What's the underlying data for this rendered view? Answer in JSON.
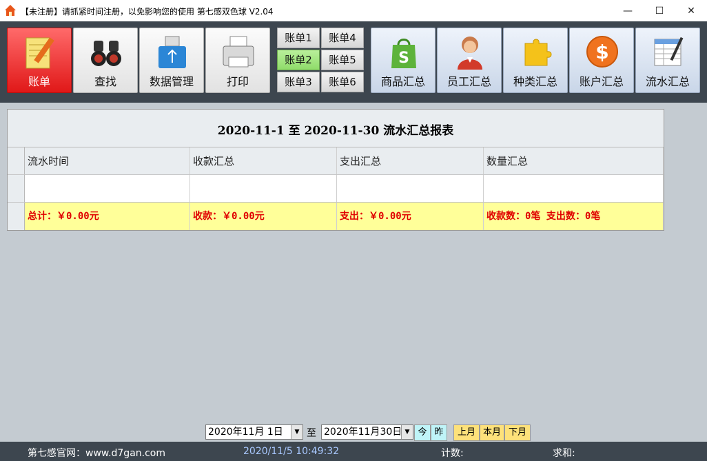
{
  "window": {
    "title": "【未注册】请抓紧时间注册，以免影响您的使用    第七感双色球   V2.04",
    "minimize": "—",
    "maximize": "☐",
    "close": "✕"
  },
  "toolbar": {
    "buttons_left": [
      {
        "label": "账单",
        "icon": "notepad-pencil-icon",
        "active": true
      },
      {
        "label": "查找",
        "icon": "binoculars-icon"
      },
      {
        "label": "数据管理",
        "icon": "usb-drive-icon"
      },
      {
        "label": "打印",
        "icon": "printer-icon"
      }
    ],
    "ledger_buttons": [
      "账单1",
      "账单4",
      "账单2",
      "账单5",
      "账单3",
      "账单6"
    ],
    "selected_ledger": "账单2",
    "buttons_right": [
      {
        "label": "商品汇总",
        "icon": "shopping-bag-icon"
      },
      {
        "label": "员工汇总",
        "icon": "person-icon"
      },
      {
        "label": "种类汇总",
        "icon": "puzzle-piece-icon"
      },
      {
        "label": "账户汇总",
        "icon": "dollar-coin-icon"
      },
      {
        "label": "流水汇总",
        "icon": "spreadsheet-pen-icon"
      }
    ]
  },
  "report": {
    "title": "2020-11-1  至  2020-11-30  流水汇总报表",
    "columns": [
      "流水时间",
      "收款汇总",
      "支出汇总",
      "数量汇总"
    ],
    "empty_row": [
      "",
      "",
      "",
      ""
    ],
    "totals": [
      "总计：￥0.00元",
      "收款：￥0.00元",
      "支出：￥0.00元",
      "收款数：0笔   支出数：0笔"
    ]
  },
  "date_range": {
    "start": "2020年11月 1日",
    "to_label": "至",
    "end": "2020年11月30日",
    "today_btn": "今",
    "yesterday_btn": "昨",
    "prev_month": "上月",
    "this_month": "本月",
    "next_month": "下月"
  },
  "status": {
    "website": "第七感官网：www.d7gan.com",
    "datetime": "2020/11/5 10:49:32",
    "count_label": "计数:",
    "sum_label": "求和:"
  },
  "colors": {
    "accent_red": "#e01818",
    "total_row_bg": "#ffff99",
    "total_text": "#e00000",
    "ledger_selected": "#8fdc6a"
  }
}
